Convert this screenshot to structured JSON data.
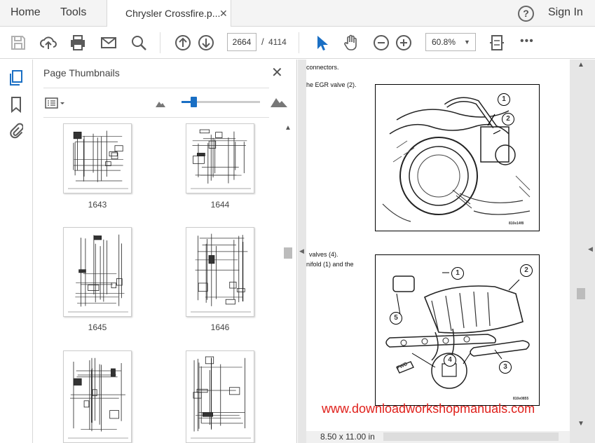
{
  "tabbar": {
    "home": "Home",
    "tools": "Tools",
    "doc_tab_title": "Chrysler Crossfire.p...",
    "doc_tab_close": "✕",
    "help": "?",
    "sign_in": "Sign In"
  },
  "toolbar": {
    "current_page": "2664",
    "page_separator": "/",
    "total_pages": "4114",
    "zoom": "60.8%",
    "more": "•••"
  },
  "thumbnails": {
    "title": "Page Thumbnails",
    "close": "✕",
    "size_slider_level": 0.15,
    "pages": [
      "1643",
      "1644",
      "1645",
      "1646",
      "",
      ""
    ]
  },
  "document": {
    "line1": "connectors.",
    "line2": "he EGR valve (2).",
    "line3": "valves (4).",
    "line4": "nifold (1) and the",
    "fig1_code": "810e14f8",
    "fig2_code": "810e0855",
    "fig1_callouts": [
      "1",
      "2"
    ],
    "fig2_callouts": [
      "1",
      "2",
      "3",
      "4",
      "5"
    ],
    "fig2_arrow_label": "FWD",
    "watermark": "www.downloadworkshopmanuals.com",
    "page_size": "8.50 x 11.00 in"
  },
  "colors": {
    "accent_blue": "#1a6fc4",
    "watermark_red": "#e0201b",
    "toolbar_icon": "#5a5a5a"
  }
}
